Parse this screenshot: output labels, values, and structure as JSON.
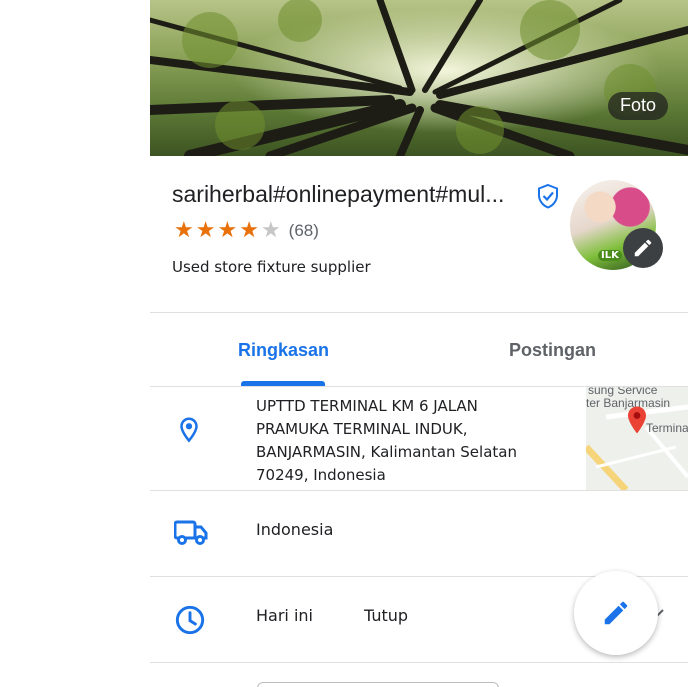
{
  "hero": {
    "photo_button_label": "Foto"
  },
  "place": {
    "title": "sariherbal#onlinepayment#mul...",
    "rating_stars": 4,
    "max_stars": 5,
    "reviews": "(68)",
    "category": "Used store fixture supplier"
  },
  "avatar": {
    "badge_text": "ILK"
  },
  "tabs": [
    {
      "label": "Ringkasan",
      "active": true
    },
    {
      "label": "Postingan",
      "active": false
    }
  ],
  "details": {
    "address_lines": [
      "UPTTD TERMINAL KM 6 JALAN",
      "PRAMUKA TERMINAL INDUK,",
      "BANJARMASIN, Kalimantan Selatan",
      "70249, Indonesia"
    ],
    "map_labels": [
      "sung Service",
      "ter Banjarmasin",
      "Termina"
    ],
    "country": "Indonesia",
    "hours_today": "Hari ini",
    "hours_status": "Tutup"
  },
  "colors": {
    "accent": "#1a73e8",
    "star": "#e8710a",
    "icon_blue": "#1a73e8",
    "map_pin": "#ea4335"
  }
}
